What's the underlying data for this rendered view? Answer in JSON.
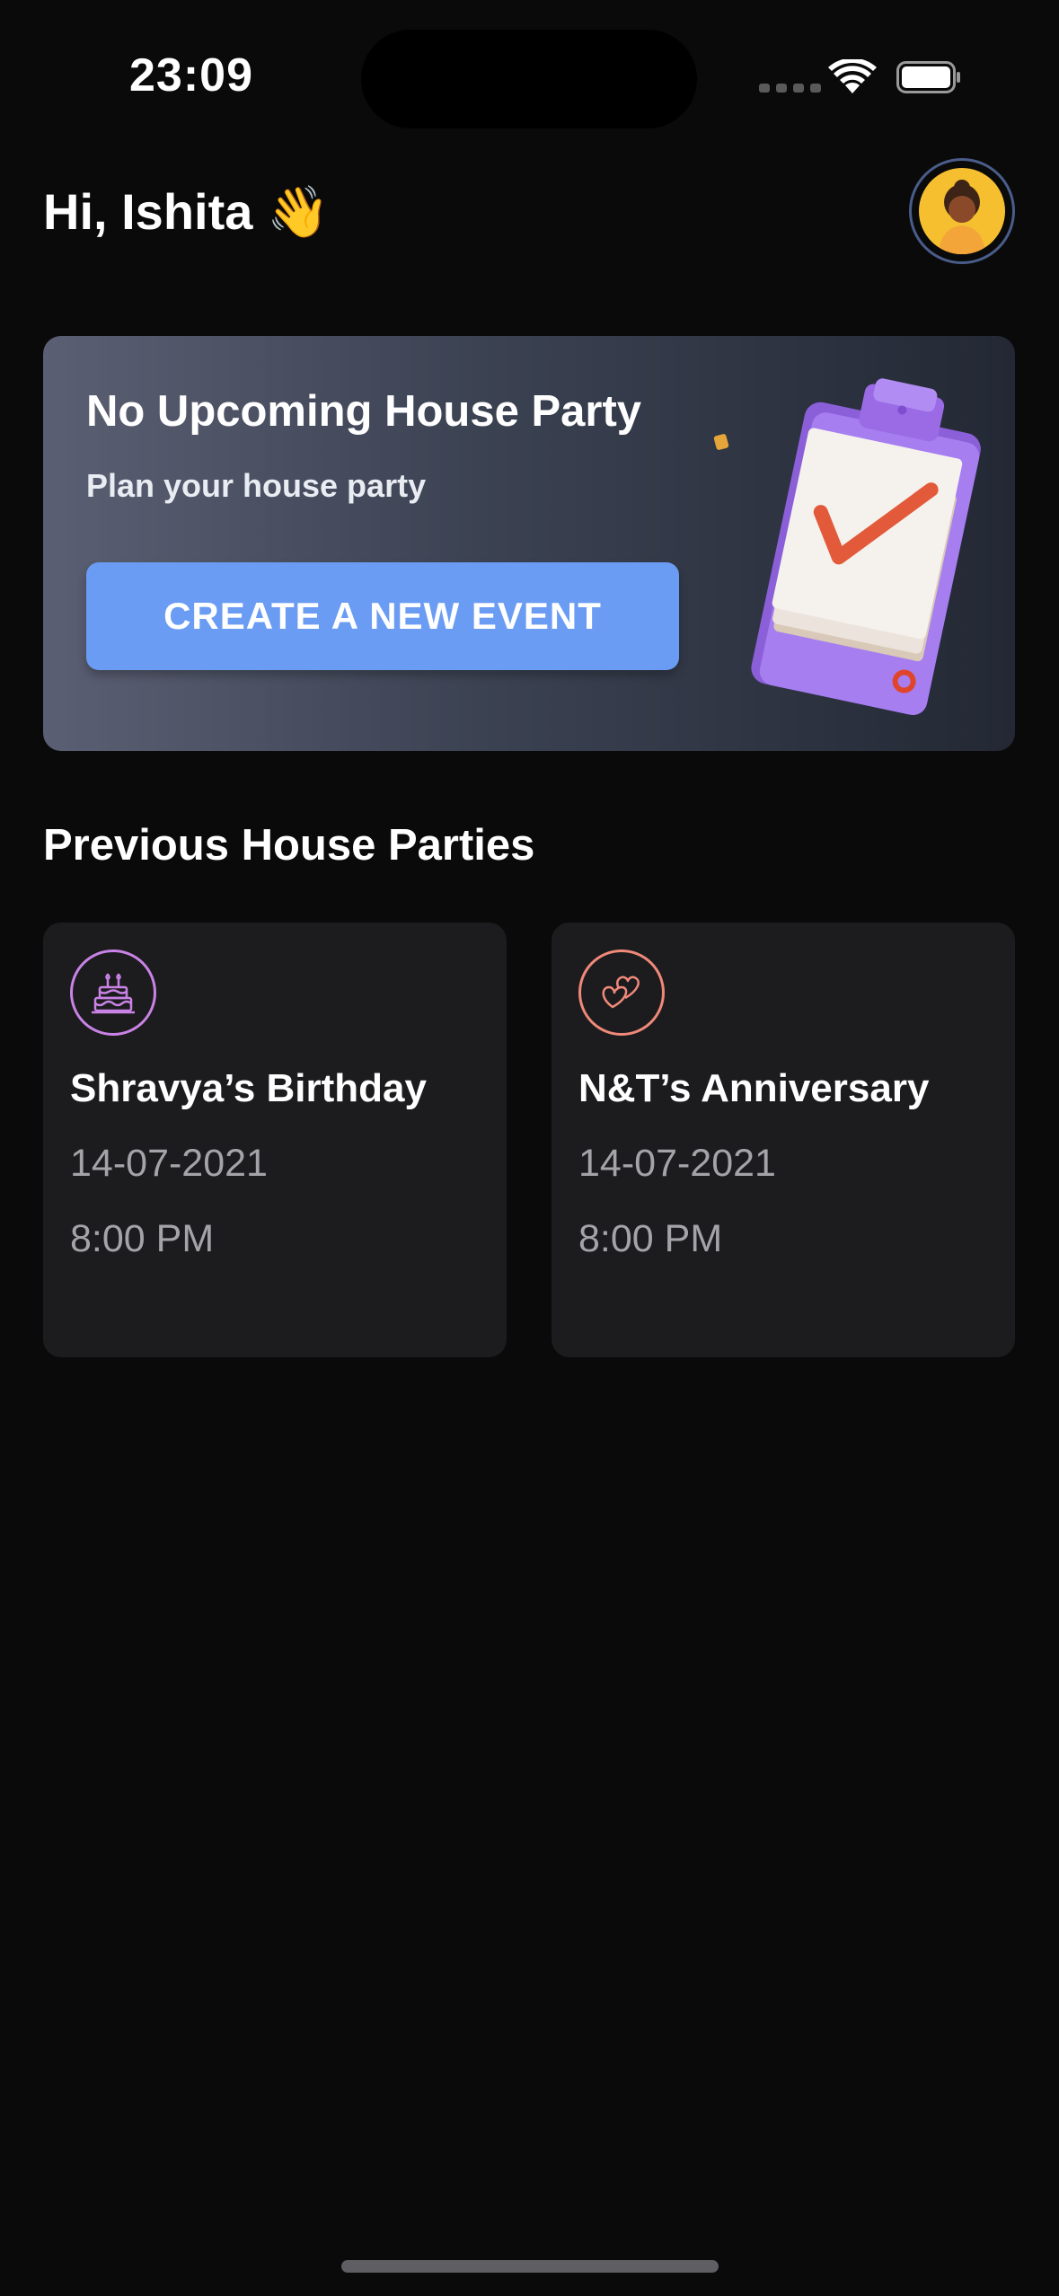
{
  "status_bar": {
    "time": "23:09"
  },
  "header": {
    "greeting": "Hi, Ishita 👋"
  },
  "hero": {
    "title": "No Upcoming House Party",
    "subtitle": "Plan your house party",
    "button_label": "CREATE A NEW EVENT"
  },
  "previous": {
    "section_title": "Previous House Parties",
    "parties": [
      {
        "name": "Shravya’s Birthday",
        "date": "14-07-2021",
        "time": "8:00 PM",
        "icon": "birthday-cake-icon",
        "accent": "#c983e6"
      },
      {
        "name": "N&T’s Anniversary",
        "date": "14-07-2021",
        "time": "8:00 PM",
        "icon": "hearts-icon",
        "accent": "#f0897a"
      }
    ]
  },
  "colors": {
    "background": "#0a0a0a",
    "card": "#1c1c1e",
    "button": "#6b9cf3",
    "avatar": "#f6bf2f"
  }
}
